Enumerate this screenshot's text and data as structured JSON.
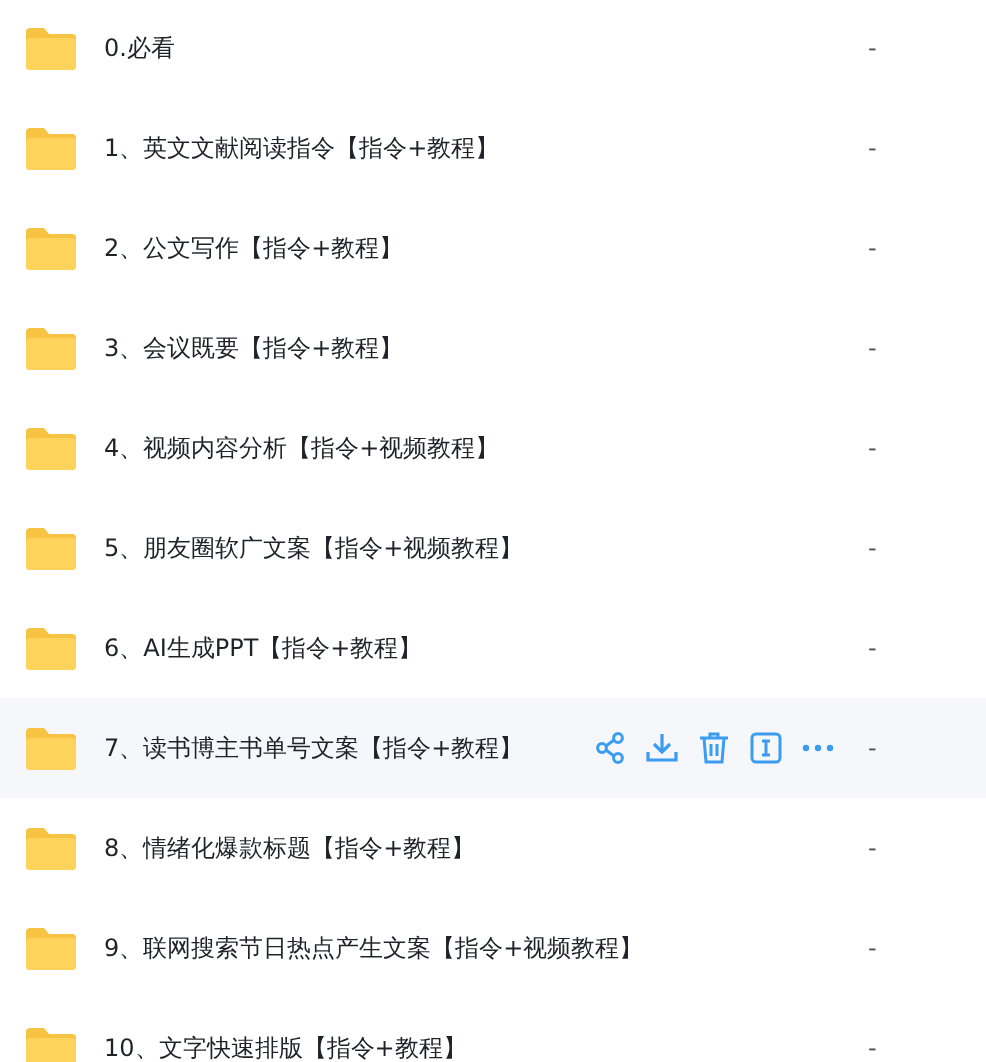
{
  "files": [
    {
      "name": "0.必看",
      "size": "-",
      "hovered": false
    },
    {
      "name": "1、英文文献阅读指令【指令+教程】",
      "size": "-",
      "hovered": false
    },
    {
      "name": "2、公文写作【指令+教程】",
      "size": "-",
      "hovered": false
    },
    {
      "name": "3、会议既要【指令+教程】",
      "size": "-",
      "hovered": false
    },
    {
      "name": "4、视频内容分析【指令+视频教程】",
      "size": "-",
      "hovered": false
    },
    {
      "name": "5、朋友圈软广文案【指令+视频教程】",
      "size": "-",
      "hovered": false
    },
    {
      "name": "6、AI生成PPT【指令+教程】",
      "size": "-",
      "hovered": false
    },
    {
      "name": "7、读书博主书单号文案【指令+教程】",
      "size": "-",
      "hovered": true
    },
    {
      "name": "8、情绪化爆款标题【指令+教程】",
      "size": "-",
      "hovered": false
    },
    {
      "name": "9、联网搜索节日热点产生文案【指令+视频教程】",
      "size": "-",
      "hovered": false
    },
    {
      "name": "10、文字快速排版【指令+教程】",
      "size": "-",
      "hovered": false
    }
  ]
}
